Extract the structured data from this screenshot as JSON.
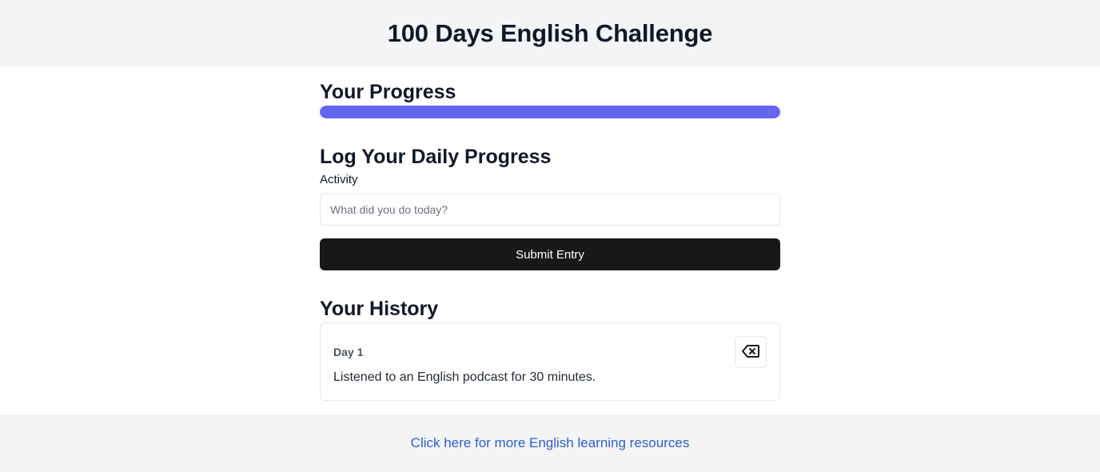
{
  "header": {
    "title": "100 Days English Challenge"
  },
  "progress": {
    "title": "Your Progress",
    "fraction": 1.0,
    "fill_color": "#6366f1"
  },
  "log": {
    "title": "Log Your Daily Progress",
    "activity_label": "Activity",
    "activity_value": "",
    "activity_placeholder": "What did you do today?",
    "submit_label": "Submit Entry"
  },
  "history": {
    "title": "Your History",
    "entries": [
      {
        "day_label": "Day 1",
        "text": "Listened to an English podcast for 30 minutes.",
        "delete_icon": "backspace-delete-icon"
      }
    ]
  },
  "footer": {
    "link_text": "Click here for more English learning resources"
  }
}
